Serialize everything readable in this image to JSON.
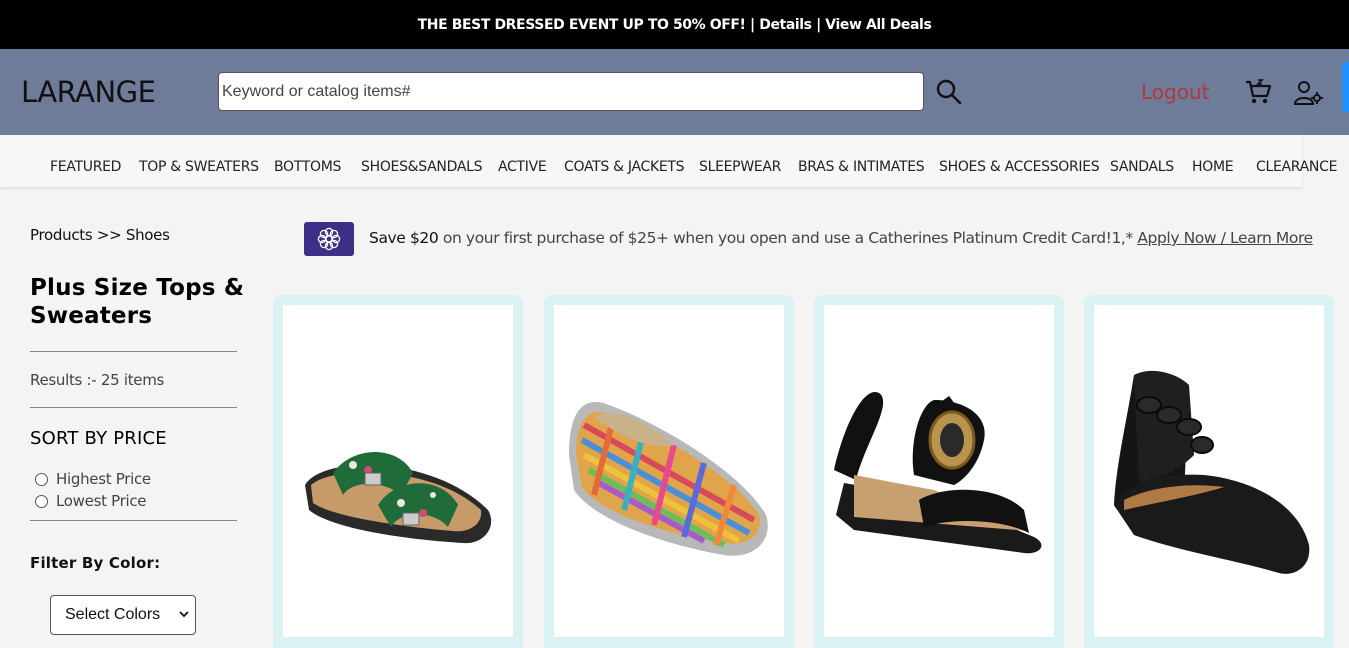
{
  "promo": {
    "text": "THE BEST DRESSED EVENT UP TO 50% OFF!",
    "sep1": " | ",
    "details": "Details",
    "sep2": " | ",
    "view_all": "View All Deals"
  },
  "header": {
    "logo": "LARANGE",
    "search_placeholder": "Keyword or catalog items#",
    "logout": "Logout",
    "icons": [
      "search-icon",
      "cart-icon",
      "account-settings-icon"
    ],
    "accent_color": "#6e7b99"
  },
  "nav": {
    "items": [
      "FEATURED",
      "TOP & SWEATERS",
      "BOTTOMS",
      "SHOES&SANDALS",
      "ACTIVE",
      "COATS & JACKETS",
      "SLEEPWEAR",
      "BRAS & INTIMATES",
      "SHOES & ACCESSORIES",
      "SANDALS",
      "HOME",
      "CLEARANCE"
    ]
  },
  "sidebar": {
    "breadcrumb": "Products >> Shoes",
    "title": "Plus Size Tops & Sweaters",
    "results": "Results :- 25 items",
    "sort_title": "SORT BY PRICE",
    "sort_options": [
      "Highest Price",
      "Lowest Price"
    ],
    "filter_title": "Filter By Color:",
    "color_select": "Select Colors"
  },
  "offer": {
    "strong": "Save $20",
    "text": " on your first purchase of $25+ when you open and use a Catherines Platinum Credit Card!1,* ",
    "link": "Apply Now / Learn More",
    "badge_color": "#3b2f86"
  },
  "products": [
    {
      "image": "floral-slide-sandal-image"
    },
    {
      "image": "woven-multicolor-flat-image"
    },
    {
      "image": "black-ring-wedge-sandal-image"
    },
    {
      "image": "black-braided-ankle-strap-flat-image"
    }
  ]
}
